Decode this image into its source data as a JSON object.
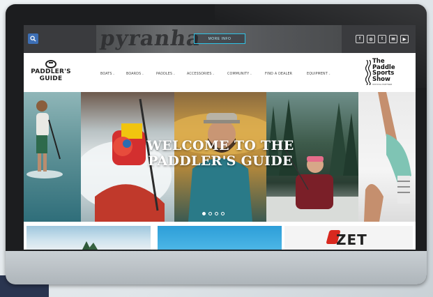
{
  "topbar": {
    "search_icon": "search-icon",
    "banner": {
      "brand": "pyranha",
      "cta_label": "MORE INFO"
    },
    "social": [
      {
        "name": "facebook-icon",
        "glyph": "f"
      },
      {
        "name": "instagram-icon",
        "glyph": "◎"
      },
      {
        "name": "twitter-icon",
        "glyph": "t"
      },
      {
        "name": "email-icon",
        "glyph": "✉"
      },
      {
        "name": "youtube-icon",
        "glyph": "▶"
      }
    ]
  },
  "nav": {
    "logo_line1": "PADDLER'S",
    "logo_line2": "GUIDE",
    "items": [
      "BOATS",
      "BOARDS",
      "PADDLES",
      "ACCESSORIES",
      "COMMUNITY",
      "FIND A DEALER",
      "EQUIPMENT"
    ],
    "show_logo": {
      "line1": "The",
      "line2": "Paddle",
      "line3": "Sports",
      "line4": "Show",
      "sub": "OFFICIAL PARTNER"
    }
  },
  "hero": {
    "title_line1": "WELCOME TO THE",
    "title_line2": "PADDLER'S GUIDE",
    "slides_count": 4,
    "active_slide": 1
  },
  "thumbs": {
    "third_brand": "ZET"
  },
  "colors": {
    "topbar_bg": "#3a3b3e",
    "search_btn": "#3d6fb5",
    "banner_cta_border": "#2fc3e6",
    "zet_red": "#d8281e"
  }
}
